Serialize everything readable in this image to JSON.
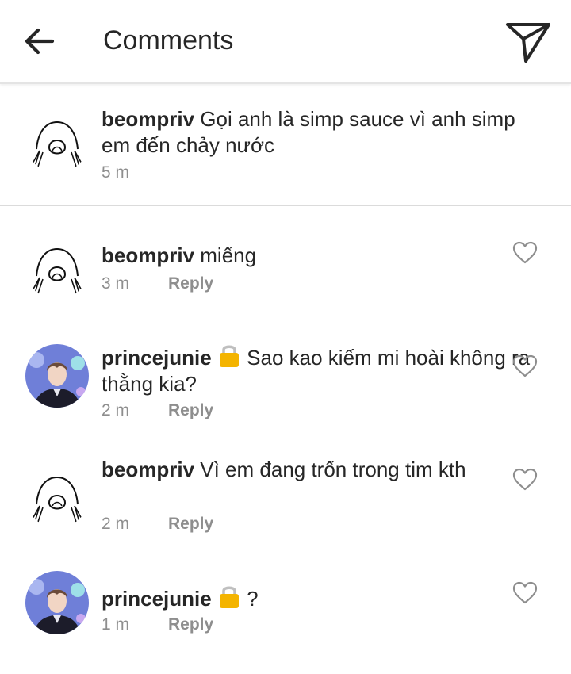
{
  "header": {
    "title": "Comments"
  },
  "caption": {
    "username": "beompriv",
    "text": "Gọi anh là simp sauce vì anh simp em đến chảy nước",
    "time": "5 m"
  },
  "comments": [
    {
      "username": "beompriv",
      "text": "miếng",
      "time": "3 m",
      "reply_label": "Reply",
      "avatar": "sketch"
    },
    {
      "username": "princejunie",
      "text": "Sao kao kiếm mi hoài không ra thằng kia?",
      "time": "2 m",
      "reply_label": "Reply",
      "avatar": "photo"
    },
    {
      "username": "beompriv",
      "text": "Vì em đang trốn trong tim kth",
      "time": "2 m",
      "reply_label": "Reply",
      "avatar": "sketch"
    },
    {
      "username": "princejunie",
      "text": "?",
      "time": "1 m",
      "reply_label": "Reply",
      "avatar": "photo"
    }
  ],
  "icons": {
    "back": "arrow-left-icon",
    "send": "paper-plane-icon",
    "like": "heart-icon",
    "lock": "lock-emoji"
  },
  "colors": {
    "meta_gray": "#8e8e8e",
    "text_dark": "#262626",
    "divider": "#dbdbdb",
    "lock_gold": "#f4b400"
  }
}
